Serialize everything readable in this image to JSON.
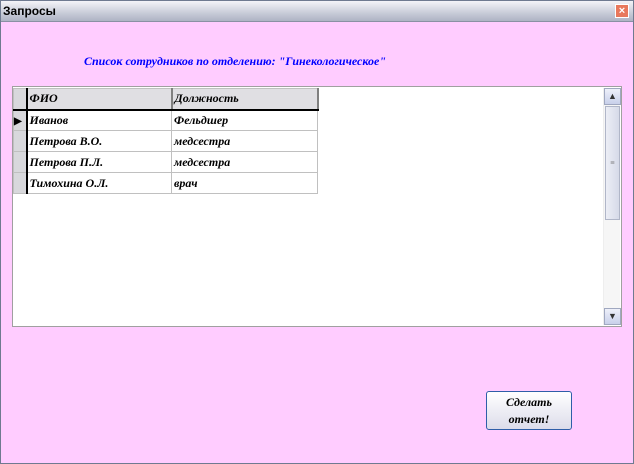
{
  "window": {
    "title": "Запросы",
    "close_icon": "close-icon"
  },
  "heading": "Список сотрудников по отделению: \"Гинекологическое\"",
  "grid": {
    "columns": [
      "ФИО",
      "Должность"
    ],
    "rows": [
      {
        "name": "Иванов",
        "position": "Фельдшер",
        "current": true
      },
      {
        "name": "Петрова В.О.",
        "position": "медсестра"
      },
      {
        "name": "Петрова П.Л.",
        "position": "медсестра"
      },
      {
        "name": "Тимохина О.Л.",
        "position": "врач"
      }
    ]
  },
  "report_button": {
    "line1": "Сделать",
    "line2": "отчет!"
  }
}
